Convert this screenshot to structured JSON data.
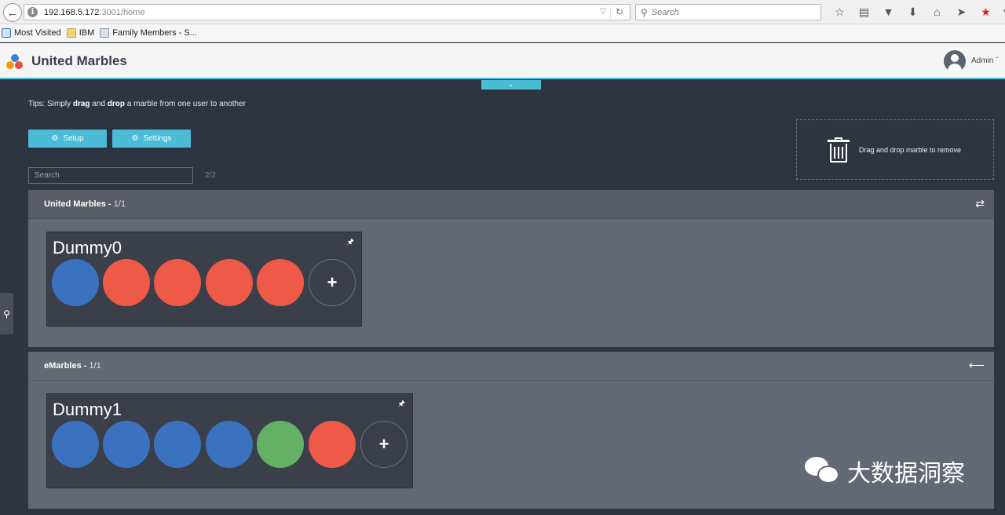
{
  "browser": {
    "url_host": "192.168.5.172",
    "url_rest": ":3001/home",
    "search_placeholder": "Search",
    "bookmarks": [
      {
        "label": "Most Visited",
        "icon": "most-visited-icon"
      },
      {
        "label": "IBM",
        "icon": "folder-icon"
      },
      {
        "label": "Family Members - S...",
        "icon": "bookmark-page-icon"
      }
    ],
    "toolbar_icons": [
      "star-icon",
      "reading-list-icon",
      "pocket-icon",
      "download-icon",
      "home-icon",
      "send-icon",
      "red-star-icon",
      "menu-chevron-icon"
    ]
  },
  "app": {
    "title": "United Marbles",
    "user": "Admin",
    "logo_colors": [
      "#e84b3c",
      "#3b7dd8",
      "#f39c12"
    ]
  },
  "tips": {
    "prefix": "Tips: Simply ",
    "drag": "drag",
    "and": " and ",
    "drop": "drop",
    "suffix": " a marble from one user to another"
  },
  "buttons": {
    "setup": "Setup",
    "settings": "Settings"
  },
  "trash": {
    "text": "Drag and drop marble to remove"
  },
  "search": {
    "placeholder": "Search",
    "count": "2/2"
  },
  "companies": [
    {
      "name": "United Marbles",
      "count": "1/1",
      "icon": "swap-arrows-icon",
      "users": [
        {
          "name": "Dummy0",
          "marbles": [
            "#3b72bf",
            "#ef5a48",
            "#ef5a48",
            "#ef5a48",
            "#ef5a48"
          ]
        }
      ]
    },
    {
      "name": "eMarbles",
      "count": "1/1",
      "icon": "arrow-left-icon",
      "users": [
        {
          "name": "Dummy1",
          "marbles": [
            "#3b72bf",
            "#3b72bf",
            "#3b72bf",
            "#3b72bf",
            "#64b065",
            "#ef5a48"
          ]
        }
      ]
    }
  ],
  "add_marble": "+",
  "watermark": "大数据洞察"
}
